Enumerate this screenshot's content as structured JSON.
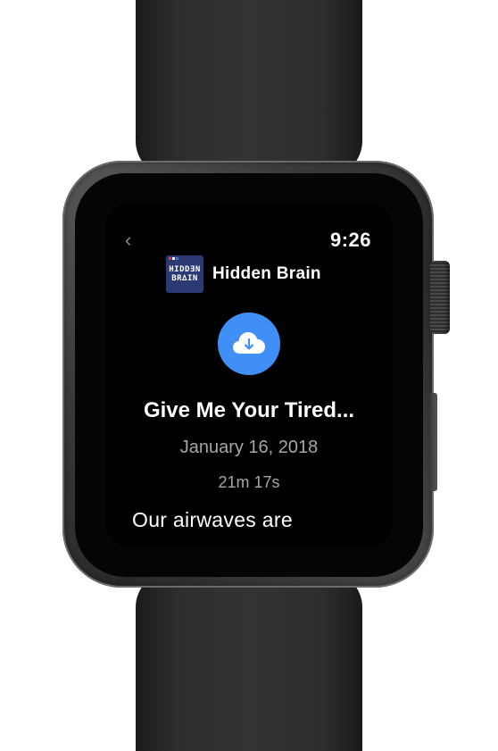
{
  "status": {
    "time": "9:26"
  },
  "nav": {
    "back_icon": "chevron-left-icon",
    "back_glyph": "‹"
  },
  "podcast": {
    "name": "Hidden Brain",
    "artwork_lines": [
      "HIDD∃N",
      "BR∆IN"
    ]
  },
  "download": {
    "icon": "cloud-download-icon",
    "color": "#3f8ff7"
  },
  "episode": {
    "title": "Give Me Your Tired...",
    "date": "January 16, 2018",
    "duration": "21m 17s",
    "description": "Our airwaves are"
  },
  "colors": {
    "background": "#000000",
    "primary_text": "#ffffff",
    "secondary_text": "#a6a6ab",
    "accent": "#3f8ff7",
    "artwork_bg": "#2b3a73"
  }
}
